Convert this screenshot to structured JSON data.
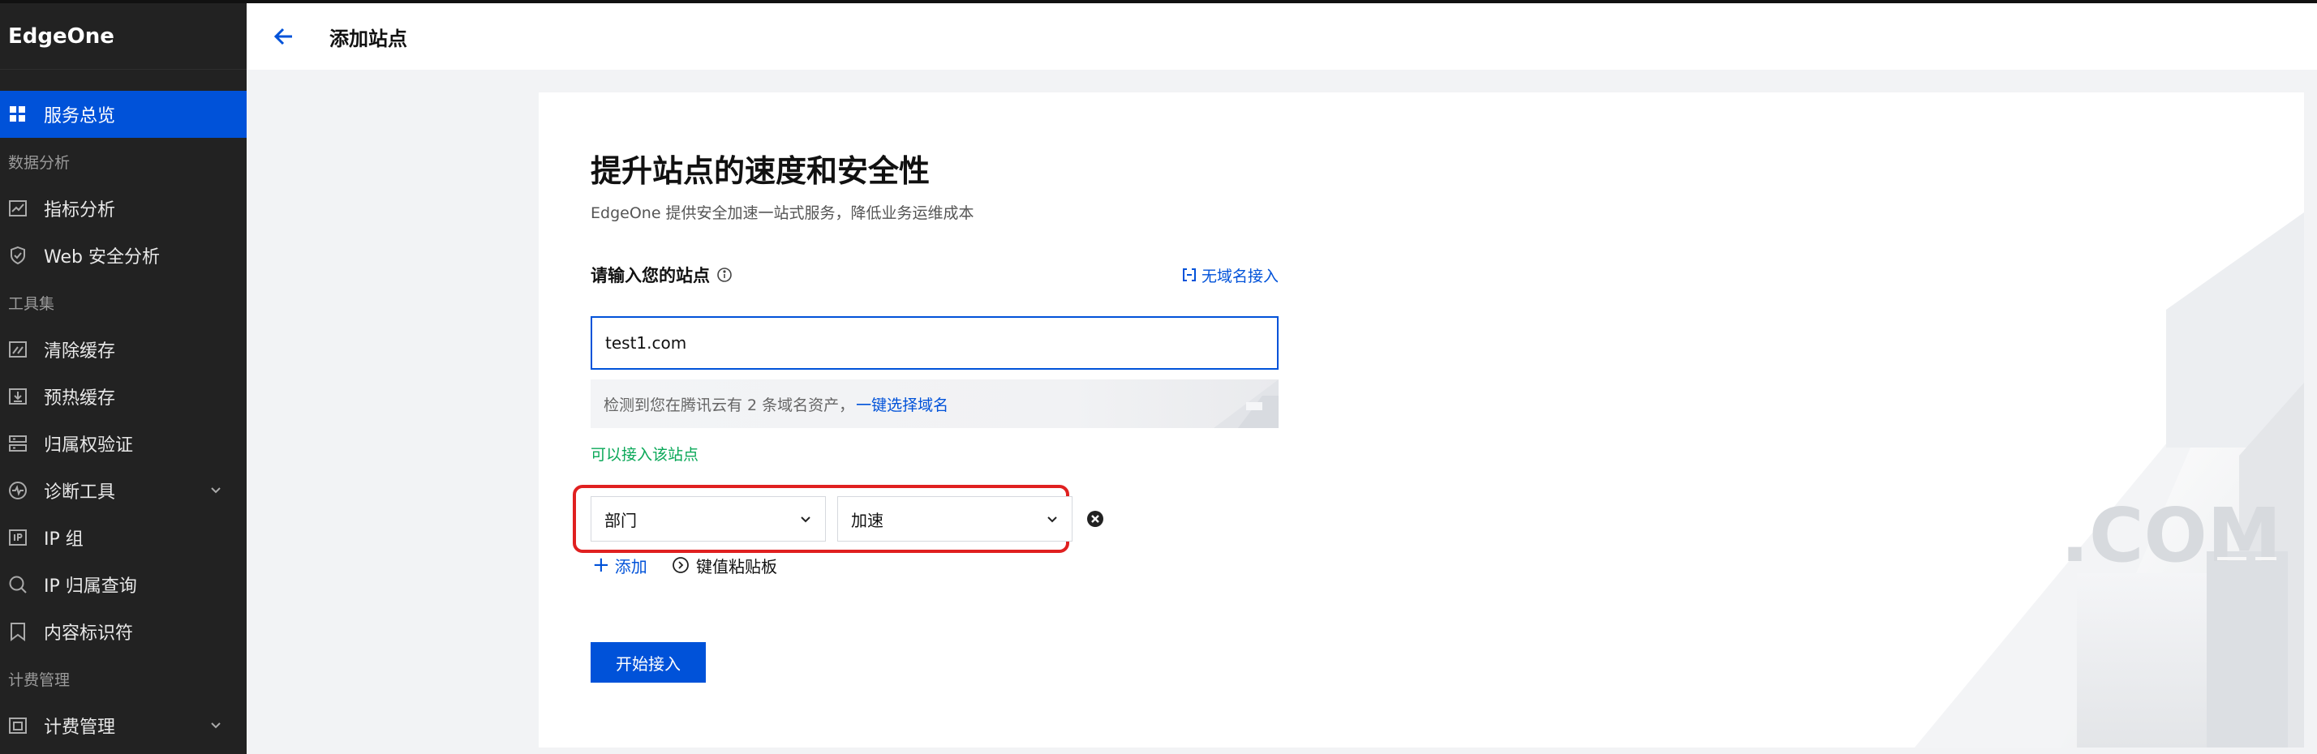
{
  "brand": "EdgeOne",
  "sidebar": {
    "overview": "服务总览",
    "group_data": "数据分析",
    "metrics": "指标分析",
    "web_security": "Web 安全分析",
    "group_tools": "工具集",
    "purge": "清除缓存",
    "prefetch": "预热缓存",
    "ownership": "归属权验证",
    "diagnose": "诊断工具",
    "ip_group": "IP 组",
    "ip_lookup": "IP 归属查询",
    "content_id": "内容标识符",
    "group_billing": "计费管理",
    "billing": "计费管理"
  },
  "header": {
    "title": "添加站点"
  },
  "main": {
    "heading": "提升站点的速度和安全性",
    "subheading": "EdgeOne 提供安全加速一站式服务，降低业务运维成本",
    "site_label": "请输入您的站点",
    "no_domain_link": "无域名接入",
    "site_input_value": "test1.com",
    "detect_text": "检测到您在腾讯云有 2 条域名资产，",
    "detect_link": "一键选择域名",
    "ok_text": "可以接入该站点",
    "tag_key": "部门",
    "tag_value": "加速",
    "add_label": "添加",
    "paste_label": "键值粘贴板",
    "start_button": "开始接入",
    "deco_text": ".COM"
  },
  "colors": {
    "primary": "#0052d9",
    "sidebar_bg": "#222222",
    "success": "#0aa858",
    "highlight": "#e02020"
  }
}
